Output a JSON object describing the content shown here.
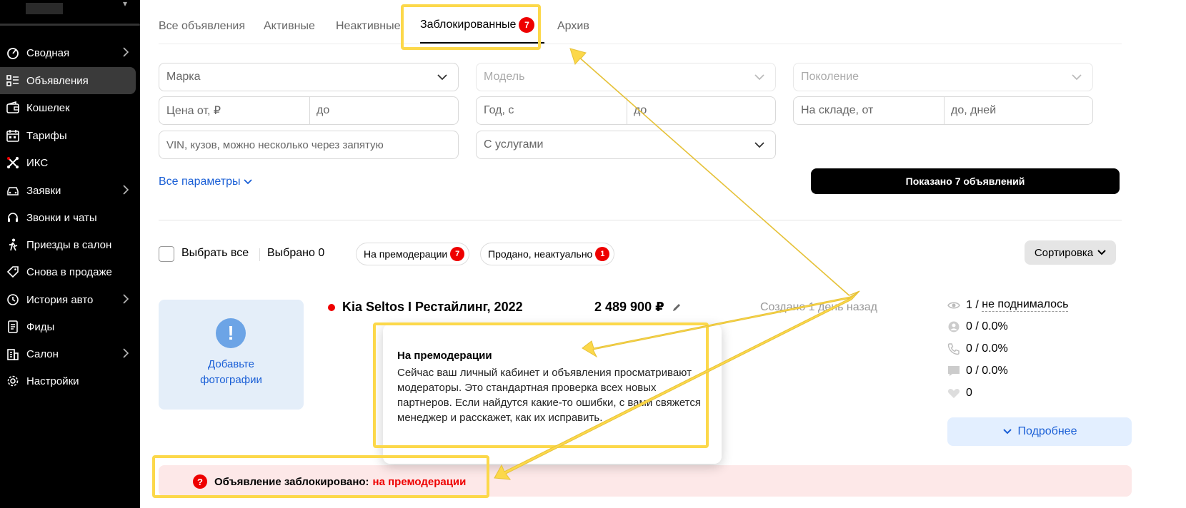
{
  "sidebar": {
    "items": [
      {
        "label": "Сводная",
        "icon": "dashboard-icon",
        "has_arrow": true
      },
      {
        "label": "Объявления",
        "icon": "list-icon",
        "has_arrow": false,
        "active": true
      },
      {
        "label": "Кошелек",
        "icon": "wallet-icon",
        "has_arrow": false
      },
      {
        "label": "Тарифы",
        "icon": "calendar-icon",
        "has_arrow": false
      },
      {
        "label": "ИКС",
        "icon": "iks-icon",
        "has_arrow": false
      },
      {
        "label": "Заявки",
        "icon": "car-icon",
        "has_arrow": true
      },
      {
        "label": "Звонки и чаты",
        "icon": "headset-icon",
        "has_arrow": false
      },
      {
        "label": "Приезды в салон",
        "icon": "walk-icon",
        "has_arrow": false
      },
      {
        "label": "Снова в продаже",
        "icon": "tag-icon",
        "has_arrow": false
      },
      {
        "label": "История авто",
        "icon": "history-icon",
        "has_arrow": true
      },
      {
        "label": "Фиды",
        "icon": "document-icon",
        "has_arrow": false
      },
      {
        "label": "Салон",
        "icon": "building-icon",
        "has_arrow": true
      },
      {
        "label": "Настройки",
        "icon": "gear-icon",
        "has_arrow": false
      }
    ]
  },
  "tabs": [
    {
      "label": "Все объявления"
    },
    {
      "label": "Активные"
    },
    {
      "label": "Неактивные"
    },
    {
      "label": "Заблокированные",
      "badge": "7",
      "active": true
    },
    {
      "label": "Архив"
    }
  ],
  "filters": {
    "brand": "Марка",
    "model": "Модель",
    "generation": "Поколение",
    "price_from": "Цена от, ₽",
    "price_to": "до",
    "year_from": "Год, с",
    "year_to": "до",
    "stock_from": "На складе, от",
    "stock_to": "до, дней",
    "vin": "VIN, кузов, можно несколько через запятую",
    "services": "С услугами",
    "all_params": "Все параметры",
    "show_button": "Показано 7 объявлений"
  },
  "toolbar": {
    "select_all": "Выбрать все",
    "selected": "Выбрано 0",
    "chip_premoderation": "На премодерации",
    "chip_premoderation_count": "7",
    "chip_sold": "Продано, неактуально",
    "chip_sold_count": "1",
    "sort": "Сортировка"
  },
  "listing": {
    "photo_line1": "Добавьте",
    "photo_line2": "фотографии",
    "title": "Kia Seltos I Рестайлинг, 2022",
    "price": "2 489 900 ₽",
    "created": "Создано 1 день назад",
    "stats": {
      "views": "1",
      "views_sep": " / ",
      "raised": "не поднималось",
      "contacts": "0 / 0.0%",
      "calls": "0 / 0.0%",
      "chats": "0 / 0.0%",
      "favorites": "0"
    },
    "more": "Подробнее",
    "blocked_label": "Объявление заблокировано:",
    "blocked_reason": "на премодерации"
  },
  "popup": {
    "title": "На премодерации",
    "body": "Сейчас ваш личный кабинет и объявления просматривают модераторы. Это стандартная проверка всех новых партнеров. Если найдутся какие-то ошибки, с вами свяжется менеджер и расскажет, как их исправить."
  },
  "colors": {
    "accent": "#1a5fd6",
    "badge": "#ee0000",
    "highlight": "#fcd84a",
    "blocked_bg": "#fde8e8"
  }
}
